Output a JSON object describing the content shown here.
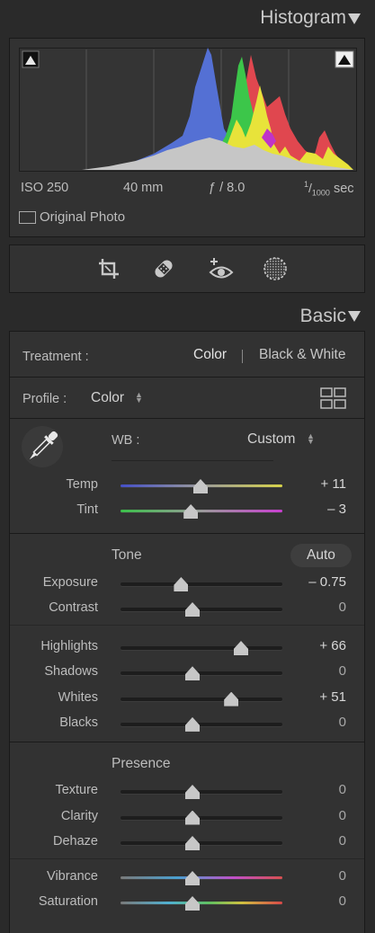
{
  "histogram": {
    "title": "Histogram",
    "info": {
      "iso": "ISO 250",
      "focal": "40 mm",
      "aperture": "ƒ / 8.0",
      "shutter_num": "1",
      "shutter_den": "1000",
      "shutter_unit": "sec"
    },
    "original_photo_label": "Original Photo"
  },
  "tools": [
    "crop-icon",
    "healing-icon",
    "redeye-icon",
    "mask-icon"
  ],
  "basic": {
    "title": "Basic",
    "treatment": {
      "label": "Treatment :",
      "color": "Color",
      "bw": "Black & White"
    },
    "profile": {
      "label": "Profile :",
      "value": "Color"
    },
    "wb": {
      "label": "WB :",
      "value": "Custom"
    },
    "sliders_wb": [
      {
        "label": "Temp",
        "value": "+ 11",
        "level": 0.55
      },
      {
        "label": "Tint",
        "value": "– 3",
        "level": 0.49
      }
    ],
    "tone": {
      "label": "Tone",
      "auto": "Auto",
      "sliders_a": [
        {
          "label": "Exposure",
          "value": "– 0.75",
          "level": 0.43
        },
        {
          "label": "Contrast",
          "value": "0",
          "level": 0.5
        }
      ],
      "sliders_b": [
        {
          "label": "Highlights",
          "value": "+ 66",
          "level": 0.8
        },
        {
          "label": "Shadows",
          "value": "0",
          "level": 0.5
        },
        {
          "label": "Whites",
          "value": "+ 51",
          "level": 0.74
        },
        {
          "label": "Blacks",
          "value": "0",
          "level": 0.5
        }
      ]
    },
    "presence": {
      "label": "Presence",
      "sliders_a": [
        {
          "label": "Texture",
          "value": "0",
          "level": 0.5
        },
        {
          "label": "Clarity",
          "value": "0",
          "level": 0.5
        },
        {
          "label": "Dehaze",
          "value": "0",
          "level": 0.5
        }
      ],
      "sliders_b": [
        {
          "label": "Vibrance",
          "value": "0",
          "level": 0.5
        },
        {
          "label": "Saturation",
          "value": "0",
          "level": 0.5
        }
      ]
    }
  }
}
